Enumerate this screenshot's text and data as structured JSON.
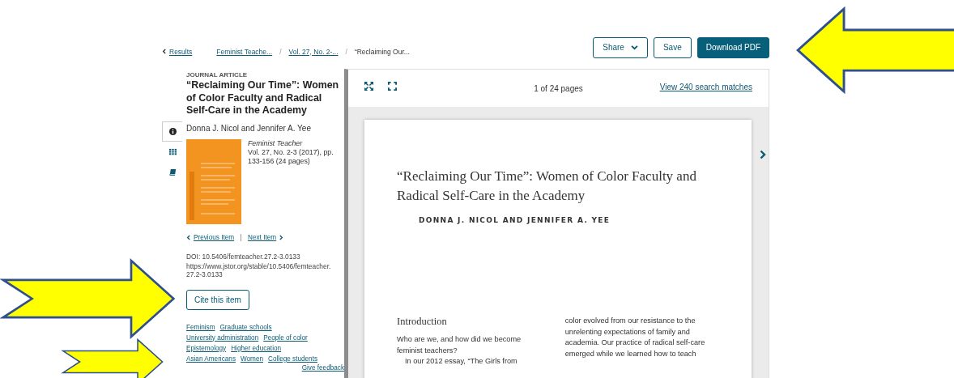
{
  "breadcrumb": {
    "back": "Results",
    "separator": "/",
    "items": [
      {
        "label": "Feminist Teache...",
        "kind": "link"
      },
      {
        "label": "Vol. 27, No. 2-...",
        "kind": "link"
      },
      {
        "label": "“Reclaiming Our...",
        "kind": "current"
      }
    ]
  },
  "actions": [
    {
      "label": "Share",
      "kind": "dropdown"
    },
    {
      "label": "Save",
      "kind": "outline"
    },
    {
      "label": "Download PDF",
      "kind": "primary"
    }
  ],
  "side_tabs": [
    {
      "kind": "info",
      "selected": true
    },
    {
      "kind": "grid",
      "selected": false
    },
    {
      "kind": "book",
      "selected": false
    }
  ],
  "article": {
    "type_label": "JOURNAL ARTICLE",
    "title": "“Reclaiming Our Time”: Women of Color Faculty and Radical Self-Care in the Academy",
    "authors": "Donna J. Nicol and Jennifer A. Yee",
    "journal": "Feminist Teacher",
    "citation": "Vol. 27, No. 2-3 (2017), pp. 133-156 (24 pages)",
    "previous": "Previous Item",
    "next": "Next Item",
    "doi": "DOI: 10.5406/femteacher.27.2-3.0133",
    "url": "https://www.jstor.org/stable/10.5406/femteacher.27.2-3.0133",
    "cite_button": "Cite this item",
    "subjects": [
      "Feminism",
      "Graduate schools",
      "University administration",
      "People of color",
      "Epistemology",
      "Higher education",
      "Asian Americans",
      "Women",
      "College students"
    ],
    "feedback": "Give feedback"
  },
  "viewer": {
    "page_count": "1 of 24 pages",
    "search_link": "View 240 search matches",
    "document": {
      "title": "“Reclaiming Our Time”: Women of Color Faculty and Radical Self-Care in the Academy",
      "authors": "DONNA J. NICOL AND JENNIFER A. YEE",
      "heading": "Introduction",
      "left_paragraphs": [
        "Who are we, and how did we become feminist teachers?",
        "In our 2012 essay, “The Girls from"
      ],
      "right_text": "color evolved from our resistance to the unrelenting expectations of family and academia. Our practice of radical self-care emerged while we learned how to teach"
    }
  },
  "annotations": [
    {
      "kind": "left-arrow"
    },
    {
      "kind": "right-arrow"
    },
    {
      "kind": "right-arrow"
    }
  ]
}
